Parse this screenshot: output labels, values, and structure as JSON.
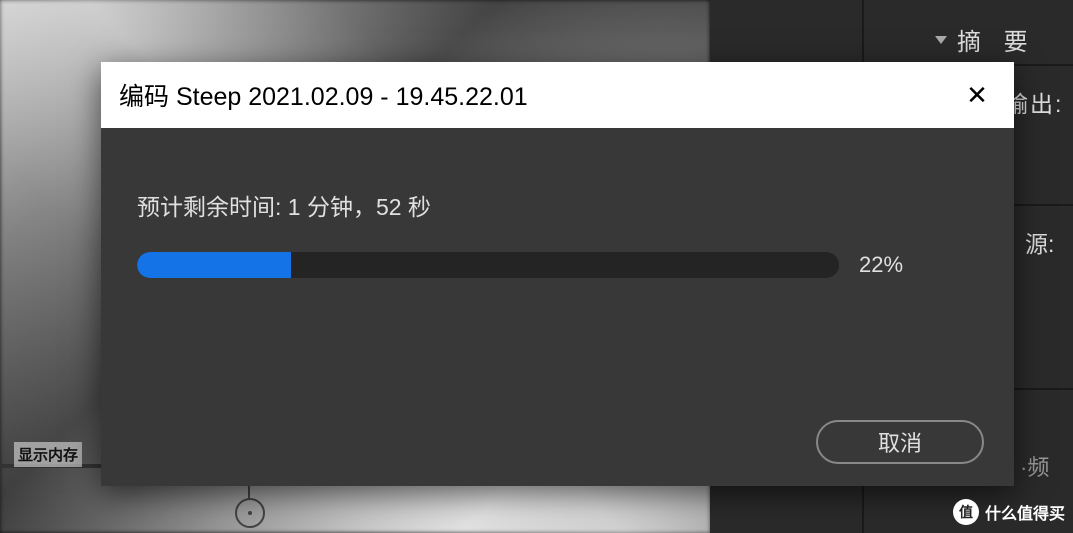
{
  "background": {
    "display_memory_label": "显示内存"
  },
  "right_panel": {
    "summary_label": "摘 要",
    "output_label": "输出:",
    "source_label": "源:",
    "video_label": "·频"
  },
  "dialog": {
    "title": "编码 Steep 2021.02.09 - 19.45.22.01",
    "time_remaining_label": "预计剩余时间:",
    "time_remaining_value": "1 分钟，52 秒",
    "progress_percent": 22,
    "progress_percent_label": "22%",
    "cancel_label": "取消"
  },
  "watermark": {
    "icon_text": "值",
    "text": "什么值得买"
  }
}
